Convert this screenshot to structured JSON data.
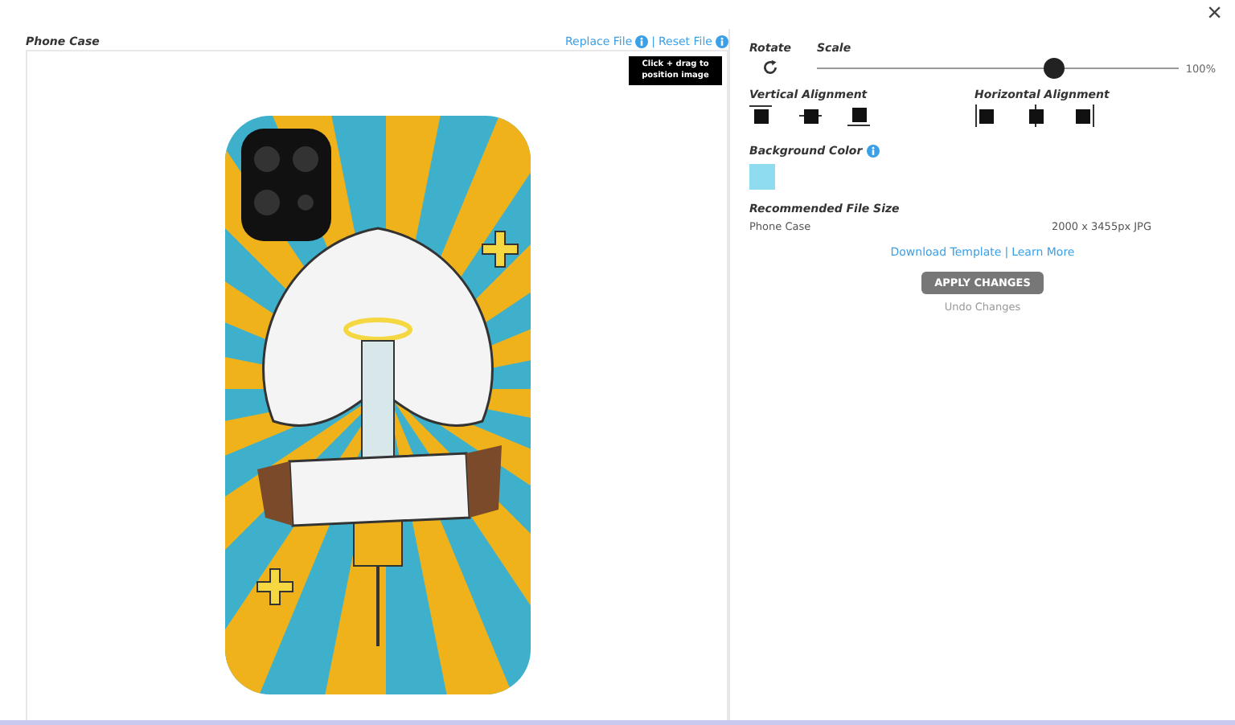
{
  "close_button": {
    "label": "×"
  },
  "preview": {
    "title": "Phone Case",
    "links": [
      {
        "label": "Replace File"
      },
      {
        "label": "Reset File"
      }
    ],
    "separator": "|",
    "hint": "Click + drag to position image"
  },
  "controls": {
    "rotate": {
      "label": "Rotate"
    },
    "scale": {
      "label": "Scale",
      "level": 0.65,
      "reading": "100%"
    },
    "vertical_alignment": {
      "label": "Vertical Alignment",
      "options": [
        {
          "kind": "top"
        },
        {
          "kind": "middle"
        },
        {
          "kind": "bottom"
        }
      ]
    },
    "horizontal_alignment": {
      "label": "Horizontal Alignment",
      "options": [
        {
          "kind": "left"
        },
        {
          "kind": "center"
        },
        {
          "kind": "right"
        }
      ]
    },
    "background_color": {
      "label": "Background Color",
      "color": "#8fdcf0"
    },
    "file_size": {
      "label": "Recommended File Size",
      "product": "Phone Case",
      "size": "2000 x 3455px JPG"
    },
    "links": [
      {
        "label": "Download Template"
      },
      {
        "label": "Learn More"
      }
    ],
    "separator": "|",
    "buttons": [
      {
        "label": "APPLY CHANGES",
        "disabled": false
      },
      {
        "label": "Undo Changes",
        "disabled": true
      }
    ]
  }
}
